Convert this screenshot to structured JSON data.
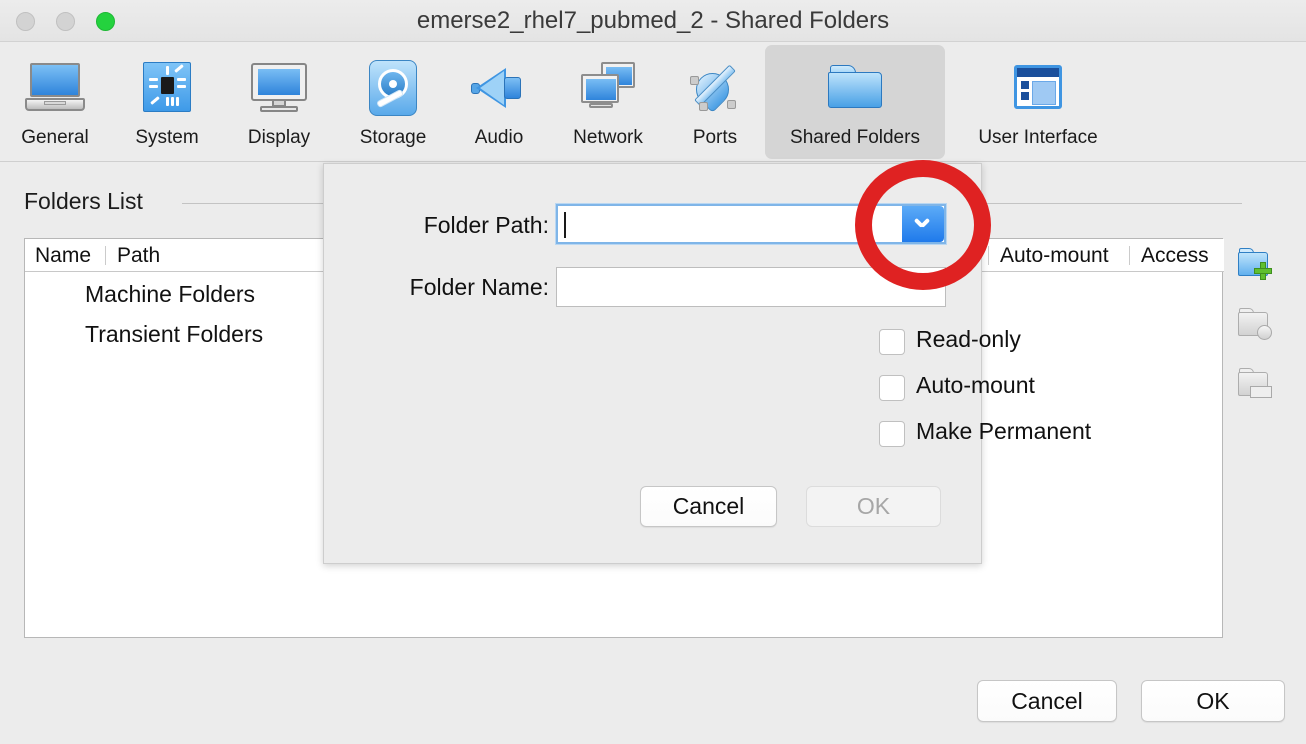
{
  "window": {
    "title": "emerse2_rhel7_pubmed_2 - Shared Folders",
    "traffic_lights": [
      {
        "name": "close",
        "color": "#d3d3d3"
      },
      {
        "name": "minimize",
        "color": "#d3d3d3"
      },
      {
        "name": "zoom",
        "color": "#24d23e"
      }
    ]
  },
  "toolbar": {
    "tabs": [
      {
        "label": "General",
        "icon": "computer-icon",
        "selected": false
      },
      {
        "label": "System",
        "icon": "chip-icon",
        "selected": false
      },
      {
        "label": "Display",
        "icon": "monitor-icon",
        "selected": false
      },
      {
        "label": "Storage",
        "icon": "harddisk-icon",
        "selected": false
      },
      {
        "label": "Audio",
        "icon": "speaker-icon",
        "selected": false
      },
      {
        "label": "Network",
        "icon": "network-icon",
        "selected": false
      },
      {
        "label": "Ports",
        "icon": "plug-icon",
        "selected": false
      },
      {
        "label": "Shared Folders",
        "icon": "folder-icon",
        "selected": true
      },
      {
        "label": "User Interface",
        "icon": "window-icon",
        "selected": false
      }
    ]
  },
  "folders_section": {
    "heading": "Folders List",
    "columns": [
      "Name",
      "Path",
      "Auto-mount",
      "Access"
    ],
    "rows": [
      {
        "name": "Machine Folders",
        "path": "",
        "auto_mount": "",
        "access": ""
      },
      {
        "name": "Transient Folders",
        "path": "",
        "auto_mount": "",
        "access": ""
      }
    ],
    "side_actions": [
      {
        "name": "add-shared-folder",
        "enabled": true
      },
      {
        "name": "edit-shared-folder",
        "enabled": false
      },
      {
        "name": "remove-shared-folder",
        "enabled": false
      }
    ]
  },
  "add_folder_dialog": {
    "folder_path": {
      "label": "Folder Path:",
      "value": "",
      "focused": true,
      "dropdown_icon": "chevron-down-icon"
    },
    "folder_name": {
      "label": "Folder Name:",
      "value": ""
    },
    "checkboxes": [
      {
        "label": "Read-only",
        "checked": false
      },
      {
        "label": "Auto-mount",
        "checked": false
      },
      {
        "label": "Make Permanent",
        "checked": false
      }
    ],
    "cancel_label": "Cancel",
    "ok_label": "OK",
    "ok_enabled": false
  },
  "window_buttons": {
    "cancel_label": "Cancel",
    "ok_label": "OK"
  },
  "annotation": {
    "shape": "circle",
    "color": "#df2222",
    "target": "folder-path-dropdown-button"
  }
}
